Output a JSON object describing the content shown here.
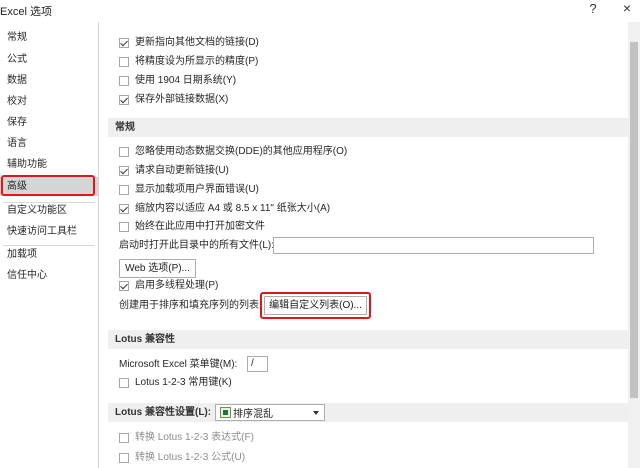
{
  "window": {
    "title": "Excel 选项",
    "help": "?",
    "close": "×"
  },
  "sidebar": {
    "items": [
      {
        "label": "常规"
      },
      {
        "label": "公式"
      },
      {
        "label": "数据"
      },
      {
        "label": "校对"
      },
      {
        "label": "保存"
      },
      {
        "label": "语言"
      },
      {
        "label": "辅助功能"
      },
      {
        "label": "高级",
        "selected": true
      },
      {
        "label": "自定义功能区"
      },
      {
        "label": "快速访问工具栏"
      },
      {
        "label": "加载项"
      },
      {
        "label": "信任中心"
      }
    ]
  },
  "workbook_options": {
    "update_links": {
      "label": "更新指向其他文档的链接(D)",
      "checked": true
    },
    "precision_as_displayed": {
      "label": "将精度设为所显示的精度(P)",
      "checked": false
    },
    "date_1904": {
      "label": "使用 1904 日期系统(Y)",
      "checked": false
    },
    "save_external_link_values": {
      "label": "保存外部链接数据(X)",
      "checked": true
    }
  },
  "general": {
    "header": "常规",
    "ignore_dde": {
      "label": "忽略使用动态数据交换(DDE)的其他应用程序(O)",
      "checked": false
    },
    "ask_update_links": {
      "label": "请求自动更新链接(U)",
      "checked": true
    },
    "show_addin_errors": {
      "label": "显示加载项用户界面错误(U)",
      "checked": false
    },
    "scale_content": {
      "label": "缩放内容以适应 A4 或 8.5 x 11\" 纸张大小(A)",
      "checked": true
    },
    "open_encrypted": {
      "label": "始终在此应用中打开加密文件",
      "checked": false
    },
    "startup_folder_label": "启动时打开此目录中的所有文件(L):",
    "startup_folder_value": "",
    "web_options_button": "Web 选项(P)...",
    "multithreaded": {
      "label": "启用多线程处理(P)",
      "checked": true
    },
    "custom_lists_label": "创建用于排序和填充序列的列表:",
    "edit_custom_lists_button": "编辑自定义列表(O)..."
  },
  "lotus_compat": {
    "header": "Lotus 兼容性",
    "menu_key_label": "Microsoft Excel 菜单键(M):",
    "menu_key_value": "/",
    "lotus_nav_keys": {
      "label": "Lotus 1-2-3 常用键(K)",
      "checked": false
    }
  },
  "lotus_settings": {
    "header": "Lotus 兼容性设置(L):",
    "sheet_select": "排序混乱",
    "formula_eval": {
      "label": "转换 Lotus 1-2-3 表达式(F)",
      "checked": false
    },
    "formula_entry": {
      "label": "转换 Lotus 1-2-3 公式(U)",
      "checked": false
    }
  },
  "colors": {
    "highlight": "#e0161d",
    "selected_nav": "#d5d5d5",
    "section_bg": "#efefef"
  }
}
